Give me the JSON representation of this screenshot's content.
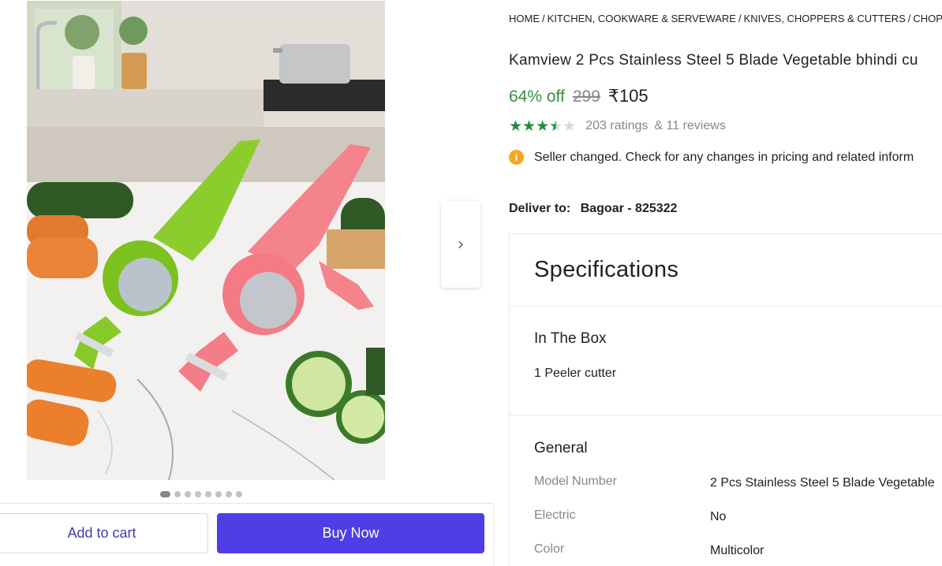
{
  "breadcrumb": [
    "HOME",
    "KITCHEN, COOKWARE & SERVEWARE",
    "KNIVES, CHOPPERS & CUTTERS",
    "CHOPPER"
  ],
  "product": {
    "title": "Kamview 2 Pcs Stainless Steel 5 Blade Vegetable bhindi cu",
    "discount": "64% off",
    "mrp": "299",
    "price": "₹105",
    "rating_value": 3.5,
    "ratings_text": "203 ratings",
    "reviews_text": "& 11 reviews",
    "star_color": "#1e8e3e"
  },
  "notice": {
    "icon": "info-icon",
    "text": "Seller changed. Check for any changes in pricing and related inform"
  },
  "delivery": {
    "label": "Deliver to:",
    "location": "Bagoar - 825322"
  },
  "gallery": {
    "image_alt": "Green and pink vegetable peeler cutters on a marble kitchen counter with cucumbers and carrots",
    "next_icon": "chevron-right-icon",
    "dot_count": 8,
    "active_dot": 0
  },
  "actions": {
    "add_to_cart": "Add to cart",
    "buy_now": "Buy Now",
    "accent": "#4f3ee6"
  },
  "specifications": {
    "heading": "Specifications",
    "in_the_box": {
      "title": "In The Box",
      "item": "1 Peeler cutter"
    },
    "general": {
      "title": "General",
      "rows": [
        {
          "key": "Model Number",
          "value": "2 Pcs Stainless Steel 5 Blade Vegetable"
        },
        {
          "key": "Electric",
          "value": "No"
        },
        {
          "key": "Color",
          "value": "Multicolor"
        }
      ]
    }
  }
}
